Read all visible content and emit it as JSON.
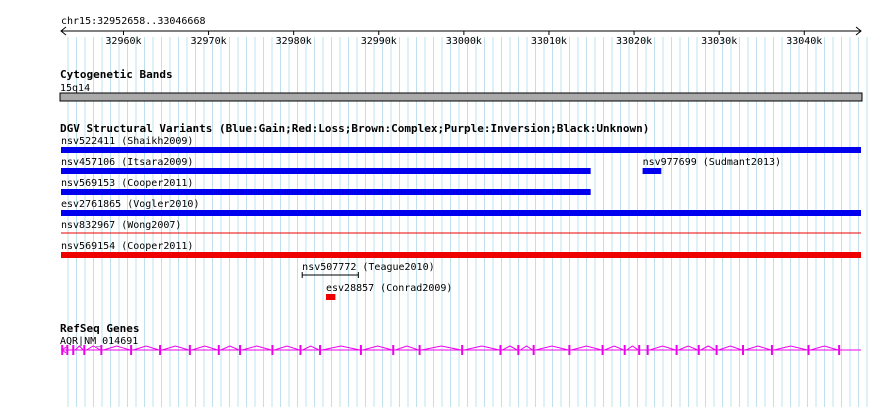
{
  "ruler": {
    "location": "chr15:32952658..33046668",
    "start": 32952658,
    "end": 33046668,
    "ticks": [
      {
        "pos": 32960000,
        "label": "32960k"
      },
      {
        "pos": 32970000,
        "label": "32970k"
      },
      {
        "pos": 32980000,
        "label": "32980k"
      },
      {
        "pos": 32990000,
        "label": "32990k"
      },
      {
        "pos": 33000000,
        "label": "33000k"
      },
      {
        "pos": 33010000,
        "label": "33010k"
      },
      {
        "pos": 33020000,
        "label": "33020k"
      },
      {
        "pos": 33030000,
        "label": "33030k"
      },
      {
        "pos": 33040000,
        "label": "33040k"
      }
    ]
  },
  "cytoband": {
    "title": "Cytogenetic Bands",
    "band_label": "15q14",
    "color": "#aaaaaa"
  },
  "dgv": {
    "title": "DGV Structural Variants (Blue:Gain;Red:Loss;Brown:Complex;Purple:Inversion;Black:Unknown)",
    "colors": {
      "gain": "#0000ee",
      "loss": "#ee0000",
      "unknown": "#000000"
    },
    "variants": [
      {
        "label": "nsv522411 (Shaikh2009)",
        "type": "gain",
        "start": 32952658,
        "end": 33046668,
        "row": 0,
        "style": "bar"
      },
      {
        "label": "nsv457106 (Itsara2009)",
        "type": "gain",
        "start": 32952658,
        "end": 33014900,
        "row": 1,
        "style": "bar"
      },
      {
        "label": "nsv977699 (Sudmant2013)",
        "type": "gain",
        "start": 33021000,
        "end": 33023200,
        "row": 1,
        "style": "bar"
      },
      {
        "label": "nsv569153 (Cooper2011)",
        "type": "gain",
        "start": 32952658,
        "end": 33014900,
        "row": 2,
        "style": "bar"
      },
      {
        "label": "esv2761865 (Vogler2010)",
        "type": "gain",
        "start": 32952658,
        "end": 33046668,
        "row": 3,
        "style": "bar"
      },
      {
        "label": "nsv832967 (Wong2007)",
        "type": "loss",
        "start": 32952658,
        "end": 33046668,
        "row": 4,
        "style": "line"
      },
      {
        "label": "nsv569154 (Cooper2011)",
        "type": "loss",
        "start": 32952658,
        "end": 33046668,
        "row": 5,
        "style": "bar"
      },
      {
        "label": "nsv507772 (Teague2010)",
        "type": "unknown",
        "start": 32981000,
        "end": 32987600,
        "row": 6,
        "style": "span"
      },
      {
        "label": "esv28857 (Conrad2009)",
        "type": "loss",
        "start": 32983800,
        "end": 32984900,
        "row": 7,
        "style": "bar"
      }
    ]
  },
  "refseq": {
    "title": "RefSeq Genes",
    "gene_label": "AQR|NM_014691",
    "color": "#ee00ee",
    "start": 32952658,
    "end": 33046668,
    "exons": [
      32952800,
      32953400,
      32954100,
      32955400,
      32957400,
      32960900,
      32964300,
      32967800,
      32971200,
      32973700,
      32977500,
      32980800,
      32983100,
      32987900,
      32991700,
      32994800,
      32999800,
      33004300,
      33006400,
      33008200,
      33012400,
      33016300,
      33018900,
      33020600,
      33021600,
      33025000,
      33027600,
      33029700,
      33032800,
      33036200,
      33040500,
      33044100
    ]
  }
}
